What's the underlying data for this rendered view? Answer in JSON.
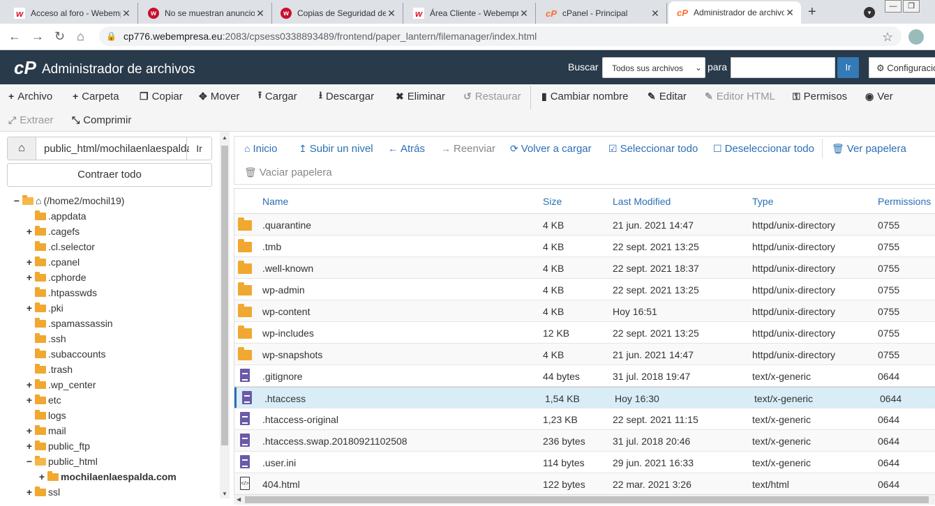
{
  "browser": {
    "tabs": [
      {
        "title": "Acceso al foro - Webempresa",
        "favicon": "w"
      },
      {
        "title": "No se muestran anuncios",
        "favicon": "w"
      },
      {
        "title": "Copias de Seguridad desde",
        "favicon": "w"
      },
      {
        "title": "Área Cliente - Webempresa",
        "favicon": "w"
      },
      {
        "title": "cPanel - Principal",
        "favicon": "cP"
      },
      {
        "title": "Administrador de archivos",
        "favicon": "cP"
      }
    ],
    "url_host": "cp776.webempresa.eu",
    "url_path": ":2083/cpsess0338893489/frontend/paper_lantern/filemanager/index.html"
  },
  "header": {
    "logo": "cP",
    "title": "Administrador de archivos",
    "search_label": "Buscar",
    "search_scope": "Todos sus archivos",
    "para_label": "para",
    "go_label": "Ir",
    "config_label": "Configuración"
  },
  "toolbar": [
    {
      "label": "Archivo",
      "icon": "plus-icon",
      "glyph": "+",
      "enabled": true
    },
    {
      "label": "Carpeta",
      "icon": "plus-icon",
      "glyph": "+",
      "enabled": true
    },
    {
      "label": "Copiar",
      "icon": "copy-icon",
      "glyph": "❐",
      "enabled": true
    },
    {
      "label": "Mover",
      "icon": "move-icon",
      "glyph": "✥",
      "enabled": true
    },
    {
      "label": "Cargar",
      "icon": "upload-icon",
      "glyph": "⭱",
      "enabled": true
    },
    {
      "label": "Descargar",
      "icon": "download-icon",
      "glyph": "⭳",
      "enabled": true
    },
    {
      "label": "Eliminar",
      "icon": "delete-icon",
      "glyph": "✖",
      "enabled": true
    },
    {
      "label": "Restaurar",
      "icon": "restore-icon",
      "glyph": "↺",
      "enabled": false
    },
    {
      "label": "Cambiar nombre",
      "icon": "rename-icon",
      "glyph": "▮",
      "enabled": true
    },
    {
      "label": "Editar",
      "icon": "edit-icon",
      "glyph": "✎",
      "enabled": true
    },
    {
      "label": "Editor HTML",
      "icon": "html-editor-icon",
      "glyph": "✎",
      "enabled": false
    },
    {
      "label": "Permisos",
      "icon": "key-icon",
      "glyph": "⚿",
      "enabled": true
    },
    {
      "label": "Ver",
      "icon": "eye-icon",
      "glyph": "◉",
      "enabled": true
    },
    {
      "label": "Extraer",
      "icon": "extract-icon",
      "glyph": "⤢",
      "enabled": false
    },
    {
      "label": "Comprimir",
      "icon": "compress-icon",
      "glyph": "⤡",
      "enabled": true
    }
  ],
  "left_panel": {
    "path_value": "public_html/mochilaenlaespalda.com",
    "go_label": "Ir",
    "collapse_label": "Contraer todo",
    "tree": [
      {
        "label": "(/home2/mochil19)",
        "depth": 0,
        "toggle": "−",
        "home": true
      },
      {
        "label": ".appdata",
        "depth": 1,
        "toggle": ""
      },
      {
        "label": ".cagefs",
        "depth": 1,
        "toggle": "+"
      },
      {
        "label": ".cl.selector",
        "depth": 1,
        "toggle": ""
      },
      {
        "label": ".cpanel",
        "depth": 1,
        "toggle": "+"
      },
      {
        "label": ".cphorde",
        "depth": 1,
        "toggle": "+"
      },
      {
        "label": ".htpasswds",
        "depth": 1,
        "toggle": ""
      },
      {
        "label": ".pki",
        "depth": 1,
        "toggle": "+"
      },
      {
        "label": ".spamassassin",
        "depth": 1,
        "toggle": ""
      },
      {
        "label": ".ssh",
        "depth": 1,
        "toggle": ""
      },
      {
        "label": ".subaccounts",
        "depth": 1,
        "toggle": ""
      },
      {
        "label": ".trash",
        "depth": 1,
        "toggle": ""
      },
      {
        "label": ".wp_center",
        "depth": 1,
        "toggle": "+"
      },
      {
        "label": "etc",
        "depth": 1,
        "toggle": "+"
      },
      {
        "label": "logs",
        "depth": 1,
        "toggle": ""
      },
      {
        "label": "mail",
        "depth": 1,
        "toggle": "+"
      },
      {
        "label": "public_ftp",
        "depth": 1,
        "toggle": "+"
      },
      {
        "label": "public_html",
        "depth": 1,
        "toggle": "−",
        "open": true
      },
      {
        "label": "mochilaenlaespalda.com",
        "depth": 2,
        "toggle": "+",
        "bold": true
      },
      {
        "label": "ssl",
        "depth": 1,
        "toggle": "+"
      }
    ]
  },
  "file_toolbar": [
    {
      "label": "Inicio",
      "icon": "home-icon",
      "glyph": "⌂",
      "enabled": true
    },
    {
      "label": "Subir un nivel",
      "icon": "level-up-icon",
      "glyph": "↥",
      "enabled": true
    },
    {
      "label": "Atrás",
      "icon": "back-arrow-icon",
      "glyph": "←",
      "enabled": true
    },
    {
      "label": "Reenviar",
      "icon": "forward-arrow-icon",
      "glyph": "→",
      "enabled": false
    },
    {
      "label": "Volver a cargar",
      "icon": "reload-icon",
      "glyph": "⟳",
      "enabled": true
    },
    {
      "label": "Seleccionar todo",
      "icon": "checked-box-icon",
      "glyph": "☑",
      "enabled": true
    },
    {
      "label": "Deseleccionar todo",
      "icon": "empty-box-icon",
      "glyph": "☐",
      "enabled": true
    },
    {
      "label": "Ver papelera",
      "icon": "trash-icon",
      "glyph": "🗑",
      "enabled": true
    },
    {
      "label": "Vaciar papelera",
      "icon": "trash-icon",
      "glyph": "🗑",
      "enabled": false
    }
  ],
  "table": {
    "columns": [
      "Name",
      "Size",
      "Last Modified",
      "Type",
      "Permissions"
    ],
    "rows": [
      {
        "icon": "dir",
        "name": ".quarantine",
        "size": "4 KB",
        "modified": "21 jun. 2021 14:47",
        "type": "httpd/unix-directory",
        "perms": "0755"
      },
      {
        "icon": "dir",
        "name": ".tmb",
        "size": "4 KB",
        "modified": "22 sept. 2021 13:25",
        "type": "httpd/unix-directory",
        "perms": "0755"
      },
      {
        "icon": "dir",
        "name": ".well-known",
        "size": "4 KB",
        "modified": "22 sept. 2021 18:37",
        "type": "httpd/unix-directory",
        "perms": "0755"
      },
      {
        "icon": "dir",
        "name": "wp-admin",
        "size": "4 KB",
        "modified": "22 sept. 2021 13:25",
        "type": "httpd/unix-directory",
        "perms": "0755"
      },
      {
        "icon": "dir",
        "name": "wp-content",
        "size": "4 KB",
        "modified": "Hoy 16:51",
        "type": "httpd/unix-directory",
        "perms": "0755"
      },
      {
        "icon": "dir",
        "name": "wp-includes",
        "size": "12 KB",
        "modified": "22 sept. 2021 13:25",
        "type": "httpd/unix-directory",
        "perms": "0755"
      },
      {
        "icon": "dir",
        "name": "wp-snapshots",
        "size": "4 KB",
        "modified": "21 jun. 2021 14:47",
        "type": "httpd/unix-directory",
        "perms": "0755"
      },
      {
        "icon": "doc",
        "name": ".gitignore",
        "size": "44 bytes",
        "modified": "31 jul. 2018 19:47",
        "type": "text/x-generic",
        "perms": "0644"
      },
      {
        "icon": "doc",
        "name": ".htaccess",
        "size": "1,54 KB",
        "modified": "Hoy 16:30",
        "type": "text/x-generic",
        "perms": "0644",
        "selected": true
      },
      {
        "icon": "doc",
        "name": ".htaccess-original",
        "size": "1,23 KB",
        "modified": "22 sept. 2021 11:15",
        "type": "text/x-generic",
        "perms": "0644"
      },
      {
        "icon": "doc",
        "name": ".htaccess.swap.20180921102508",
        "size": "236 bytes",
        "modified": "31 jul. 2018 20:46",
        "type": "text/x-generic",
        "perms": "0644"
      },
      {
        "icon": "doc",
        "name": ".user.ini",
        "size": "114 bytes",
        "modified": "29 jun. 2021 16:33",
        "type": "text/x-generic",
        "perms": "0644"
      },
      {
        "icon": "html",
        "name": "404.html",
        "size": "122 bytes",
        "modified": "22 mar. 2021 3:26",
        "type": "text/html",
        "perms": "0644"
      }
    ]
  }
}
